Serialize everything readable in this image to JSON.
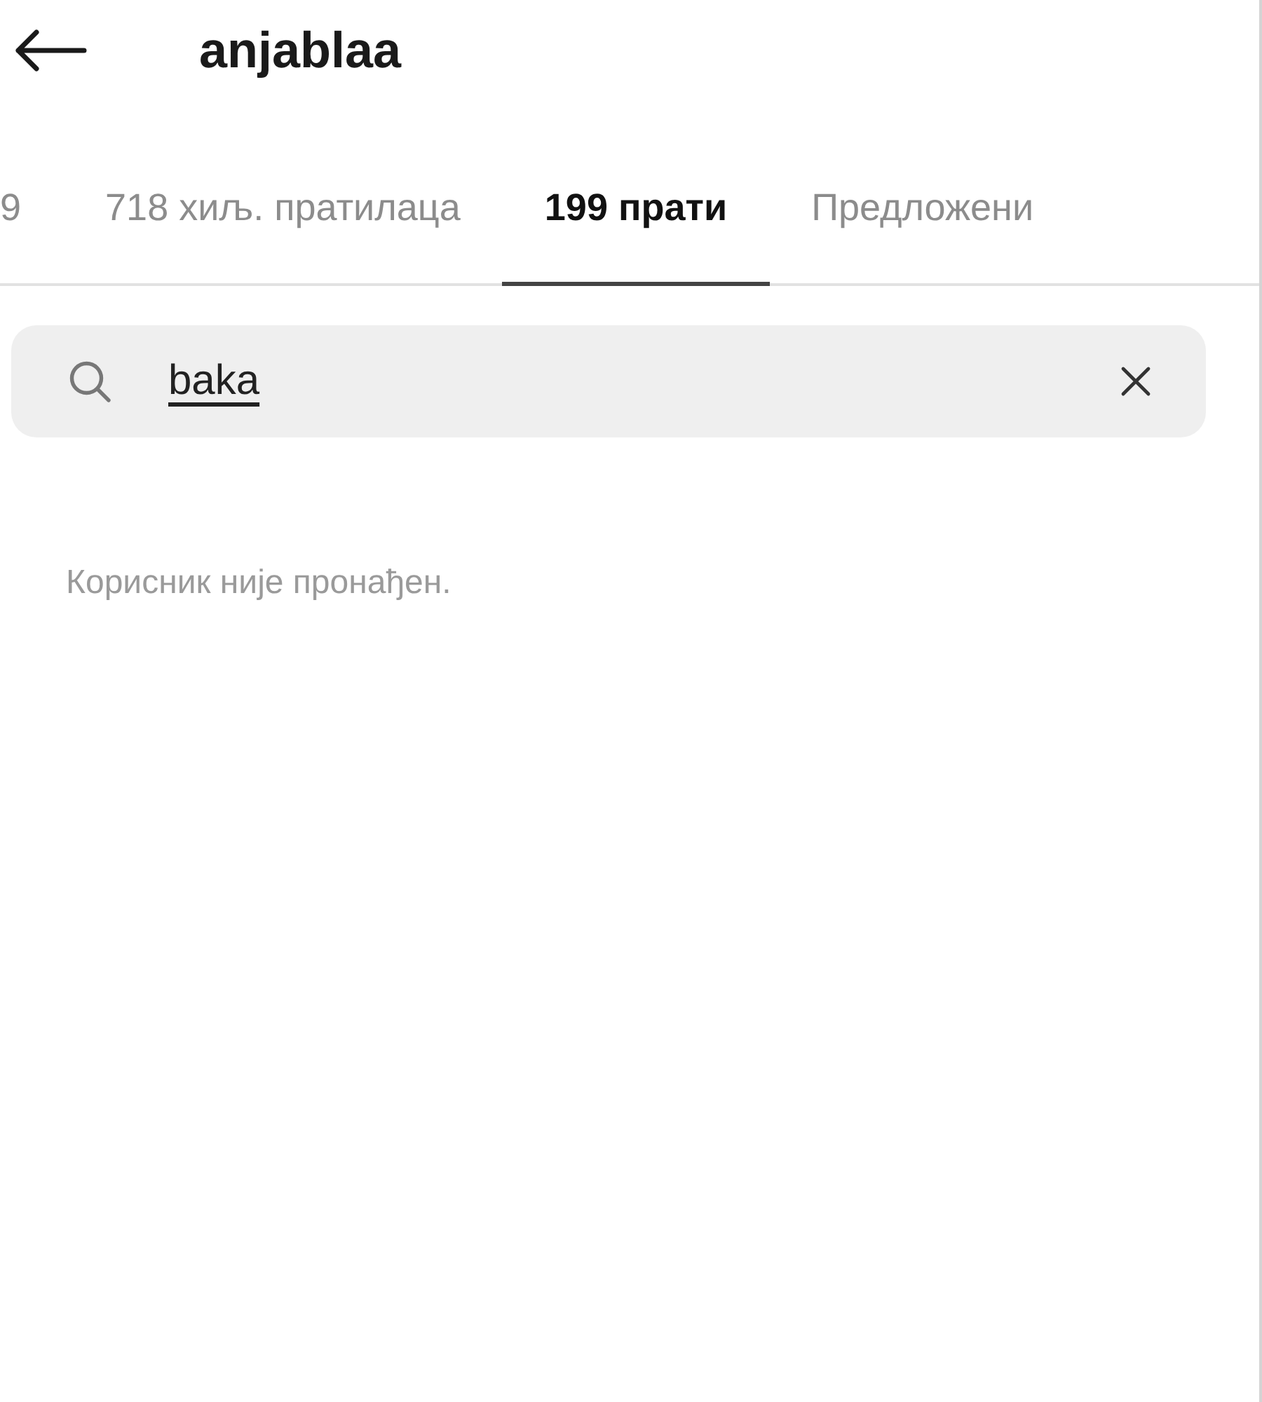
{
  "header": {
    "title": "anjablaa"
  },
  "tabs": [
    {
      "label": "9",
      "selected": false
    },
    {
      "label": "718 хиљ. пратилаца",
      "selected": false
    },
    {
      "label": "199 прати",
      "selected": true
    },
    {
      "label": "Предложени",
      "selected": false
    }
  ],
  "search": {
    "value": "baka"
  },
  "message": "Корисник није пронађен."
}
